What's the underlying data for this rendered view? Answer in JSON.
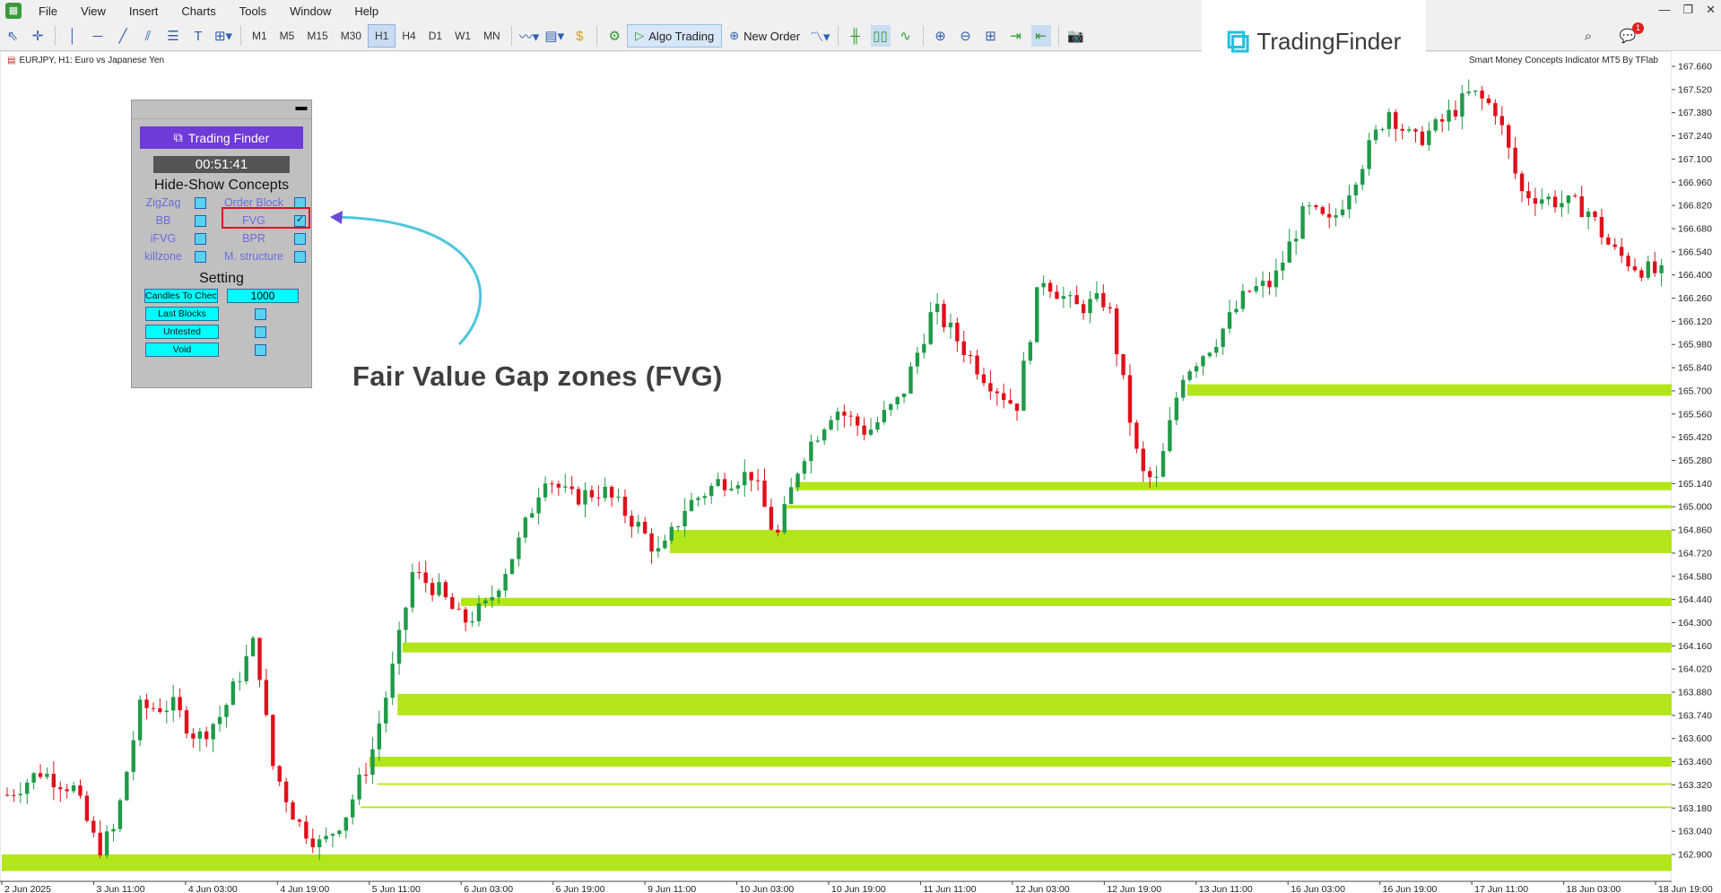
{
  "menu": [
    "File",
    "View",
    "Insert",
    "Charts",
    "Tools",
    "Window",
    "Help"
  ],
  "window_controls": [
    "—",
    "❐",
    "✕"
  ],
  "toolbar": {
    "timeframes": [
      "M1",
      "M5",
      "M15",
      "M30",
      "H1",
      "H4",
      "D1",
      "W1",
      "MN"
    ],
    "active_timeframe": "H1",
    "algo_trading_label": "Algo Trading",
    "new_order_label": "New Order"
  },
  "notification_count": "1",
  "brand": {
    "name": "TradingFinder"
  },
  "chart": {
    "symbol_line": "EURJPY, H1:  Euro vs Japanese Yen",
    "indicator_label": "Smart Money Concepts Indicator MT5 By TFlab"
  },
  "panel": {
    "brand_label": "Trading Finder",
    "timer": "00:51:41",
    "section1_title": "Hide-Show Concepts",
    "concepts": [
      {
        "label": "ZigZag",
        "checked": false
      },
      {
        "label": "Order Block",
        "checked": false
      },
      {
        "label": "BB",
        "checked": false
      },
      {
        "label": "FVG",
        "checked": true
      },
      {
        "label": "iFVG",
        "checked": false
      },
      {
        "label": "BPR",
        "checked": false
      },
      {
        "label": "killzone",
        "checked": false
      },
      {
        "label": "M. structure",
        "checked": false
      }
    ],
    "section2_title": "Setting",
    "candles_label": "Candles To Check",
    "candles_value": "1000",
    "settings": [
      {
        "label": "Last Blocks",
        "checked": false
      },
      {
        "label": "Untested",
        "checked": false
      },
      {
        "label": "Void",
        "checked": false
      }
    ]
  },
  "annotation": "Fair Value Gap zones (FVG)",
  "chart_data": {
    "type": "candlestick",
    "title": "EURJPY, H1",
    "y_range": [
      162.8,
      167.7
    ],
    "y_ticks": [
      "167.660",
      "167.520",
      "167.380",
      "167.240",
      "167.100",
      "166.960",
      "166.820",
      "166.680",
      "166.540",
      "166.400",
      "166.260",
      "166.120",
      "165.980",
      "165.840",
      "165.700",
      "165.560",
      "165.420",
      "165.280",
      "165.140",
      "165.000",
      "164.860",
      "164.720",
      "164.580",
      "164.440",
      "164.300",
      "164.160",
      "164.020",
      "163.880",
      "163.740",
      "163.600",
      "163.460",
      "163.320",
      "163.180",
      "163.040",
      "162.900"
    ],
    "x_ticks": [
      "2 Jun 2025",
      "3 Jun 11:00",
      "4 Jun 03:00",
      "4 Jun 19:00",
      "5 Jun 11:00",
      "6 Jun 03:00",
      "6 Jun 19:00",
      "9 Jun 11:00",
      "10 Jun 03:00",
      "10 Jun 19:00",
      "11 Jun 11:00",
      "12 Jun 03:00",
      "12 Jun 19:00",
      "13 Jun 11:00",
      "16 Jun 03:00",
      "16 Jun 19:00",
      "17 Jun 11:00",
      "18 Jun 03:00",
      "18 Jun 19:00"
    ],
    "path": [
      [
        0,
        163.26
      ],
      [
        0.02,
        163.4
      ],
      [
        0.04,
        163.3
      ],
      [
        0.055,
        162.93
      ],
      [
        0.065,
        163.05
      ],
      [
        0.08,
        163.78
      ],
      [
        0.1,
        163.8
      ],
      [
        0.115,
        163.6
      ],
      [
        0.13,
        163.75
      ],
      [
        0.15,
        164.2
      ],
      [
        0.16,
        163.45
      ],
      [
        0.175,
        163.1
      ],
      [
        0.19,
        162.95
      ],
      [
        0.205,
        163.15
      ],
      [
        0.22,
        163.5
      ],
      [
        0.235,
        164.1
      ],
      [
        0.245,
        164.6
      ],
      [
        0.26,
        164.5
      ],
      [
        0.275,
        164.3
      ],
      [
        0.29,
        164.4
      ],
      [
        0.31,
        164.8
      ],
      [
        0.325,
        165.2
      ],
      [
        0.34,
        165.05
      ],
      [
        0.36,
        165.1
      ],
      [
        0.38,
        164.9
      ],
      [
        0.395,
        164.7
      ],
      [
        0.41,
        165.0
      ],
      [
        0.43,
        165.15
      ],
      [
        0.45,
        165.2
      ],
      [
        0.465,
        164.8
      ],
      [
        0.48,
        165.3
      ],
      [
        0.5,
        165.6
      ],
      [
        0.52,
        165.45
      ],
      [
        0.54,
        165.65
      ],
      [
        0.56,
        166.2
      ],
      [
        0.575,
        166.0
      ],
      [
        0.59,
        165.8
      ],
      [
        0.61,
        165.6
      ],
      [
        0.625,
        166.4
      ],
      [
        0.645,
        166.2
      ],
      [
        0.665,
        166.25
      ],
      [
        0.685,
        165.2
      ],
      [
        0.695,
        165.15
      ],
      [
        0.71,
        165.8
      ],
      [
        0.73,
        166.0
      ],
      [
        0.75,
        166.3
      ],
      [
        0.765,
        166.35
      ],
      [
        0.785,
        166.8
      ],
      [
        0.8,
        166.7
      ],
      [
        0.82,
        167.1
      ],
      [
        0.835,
        167.4
      ],
      [
        0.85,
        167.2
      ],
      [
        0.865,
        167.3
      ],
      [
        0.885,
        167.5
      ],
      [
        0.9,
        167.4
      ],
      [
        0.915,
        166.9
      ],
      [
        0.935,
        166.85
      ],
      [
        0.955,
        166.8
      ],
      [
        0.97,
        166.55
      ],
      [
        0.985,
        166.45
      ],
      [
        1,
        166.4
      ]
    ],
    "fvg_zones": [
      {
        "low": 165.67,
        "high": 165.74,
        "start": 0.71
      },
      {
        "low": 165.1,
        "high": 165.15,
        "start": 0.475
      },
      {
        "low": 164.99,
        "high": 165.01,
        "start": 0.47
      },
      {
        "low": 164.72,
        "high": 164.86,
        "start": 0.4
      },
      {
        "low": 164.4,
        "high": 164.45,
        "start": 0.275
      },
      {
        "low": 164.12,
        "high": 164.18,
        "start": 0.24
      },
      {
        "low": 163.74,
        "high": 163.87,
        "start": 0.237
      },
      {
        "low": 163.43,
        "high": 163.49,
        "start": 0.22
      },
      {
        "low": 163.32,
        "high": 163.33,
        "start": 0.225
      },
      {
        "low": 163.18,
        "high": 163.19,
        "start": 0.215
      },
      {
        "low": 162.8,
        "high": 162.9,
        "start": 0
      }
    ]
  }
}
